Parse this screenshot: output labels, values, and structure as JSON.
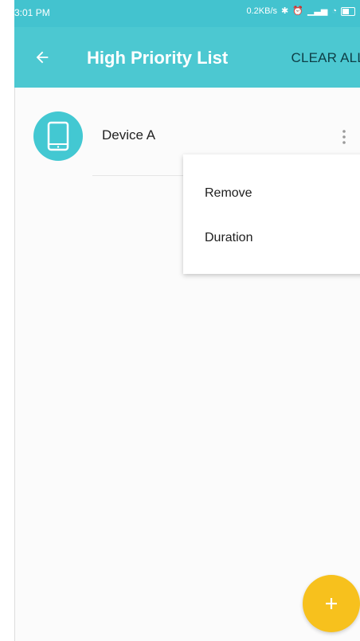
{
  "status_bar": {
    "time": "3:01 PM",
    "net_speed": "0.2KB/s"
  },
  "app_bar": {
    "title": "High Priority List",
    "clear_all_label": "CLEAR ALL",
    "back_icon": "arrow-left-icon"
  },
  "devices": [
    {
      "name": "Device A",
      "icon": "tablet-icon"
    }
  ],
  "menu": {
    "items": [
      {
        "label": "Remove"
      },
      {
        "label": "Duration"
      }
    ]
  },
  "fab": {
    "icon": "plus-icon"
  },
  "colors": {
    "accent": "#4cc8d1",
    "fab": "#f7c11d",
    "text_primary": "#222222",
    "clear_all": "#0e3e46"
  }
}
